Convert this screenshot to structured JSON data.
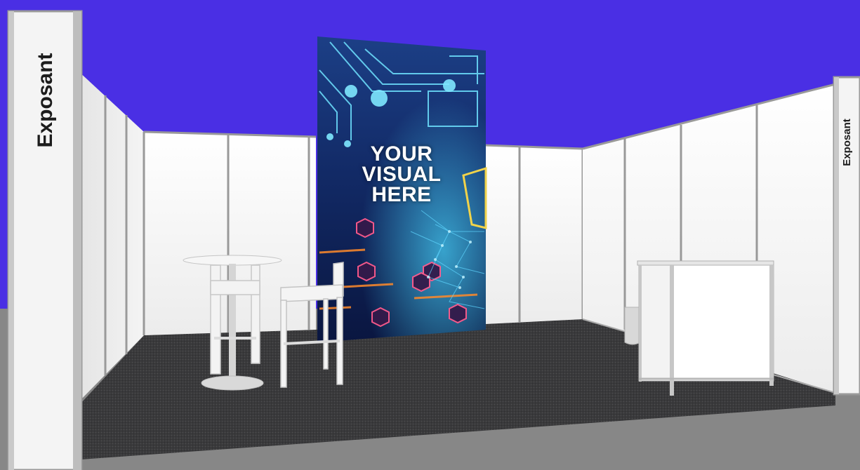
{
  "scene": {
    "background_color": "#4a2fe4",
    "floor_color": "#3a3a3c",
    "wall_color": "#f7f7f7"
  },
  "signs": {
    "left_fascia": "Exposant",
    "right_fascia": "Exposant"
  },
  "banner": {
    "line1": "YOUR",
    "line2": "VISUAL",
    "line3": "HERE"
  }
}
